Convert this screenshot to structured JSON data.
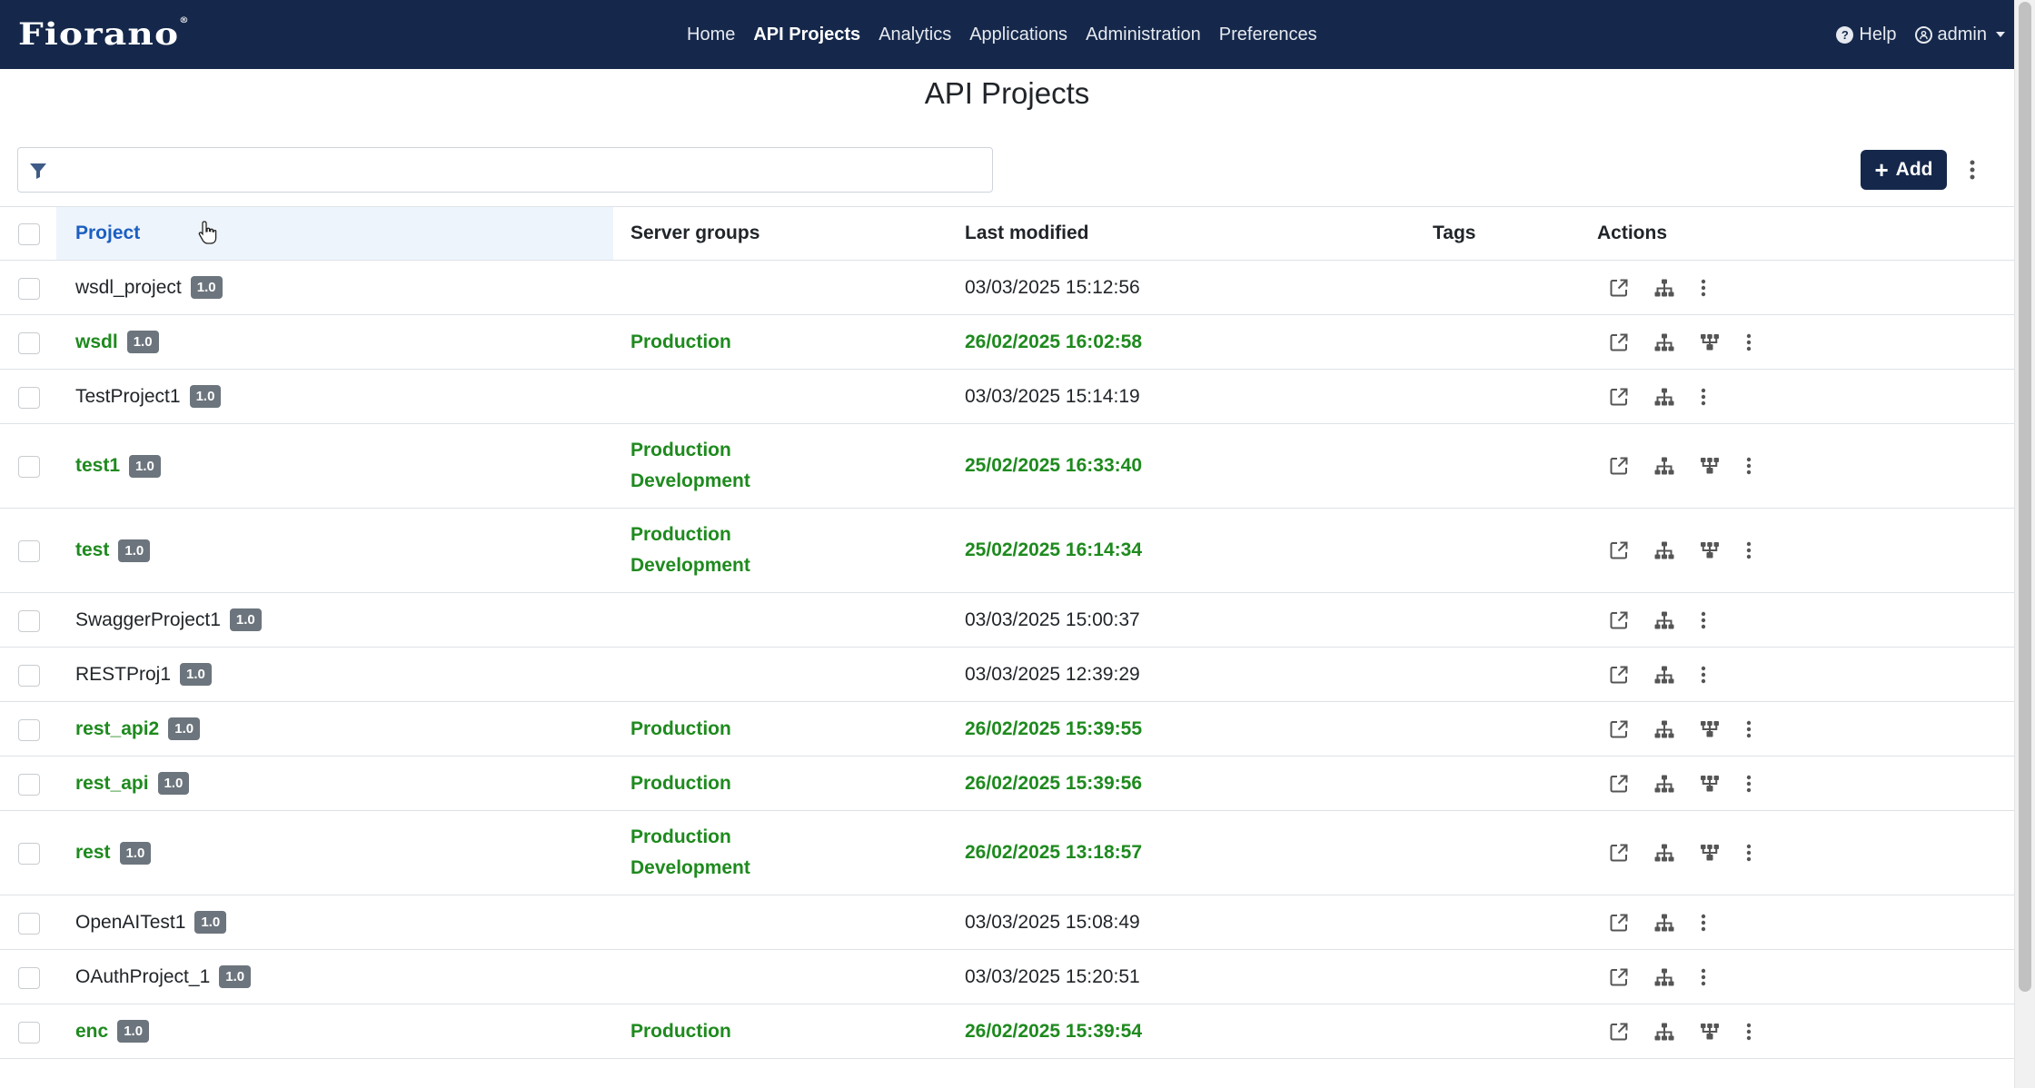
{
  "navbar": {
    "brand": "Fiorano",
    "links": [
      {
        "label": "Home",
        "active": false
      },
      {
        "label": "API Projects",
        "active": true
      },
      {
        "label": "Analytics",
        "active": false
      },
      {
        "label": "Applications",
        "active": false
      },
      {
        "label": "Administration",
        "active": false
      },
      {
        "label": "Preferences",
        "active": false
      }
    ],
    "help_label": "Help",
    "user_label": "admin",
    "icons": {
      "help": "question-circle-icon",
      "user": "user-circle-icon"
    }
  },
  "page": {
    "title": "API Projects",
    "filter_placeholder": "",
    "add_label": "Add"
  },
  "table": {
    "columns": [
      "Project",
      "Server groups",
      "Last modified",
      "Tags",
      "Actions"
    ],
    "rows": [
      {
        "name": "wsdl_project",
        "version": "1.0",
        "groups": [],
        "modified": "03/03/2025 15:12:56",
        "deployed": false
      },
      {
        "name": "wsdl",
        "version": "1.0",
        "groups": [
          "Production"
        ],
        "modified": "26/02/2025 16:02:58",
        "deployed": true
      },
      {
        "name": "TestProject1",
        "version": "1.0",
        "groups": [],
        "modified": "03/03/2025 15:14:19",
        "deployed": false
      },
      {
        "name": "test1",
        "version": "1.0",
        "groups": [
          "Production",
          "Development"
        ],
        "modified": "25/02/2025 16:33:40",
        "deployed": true
      },
      {
        "name": "test",
        "version": "1.0",
        "groups": [
          "Production",
          "Development"
        ],
        "modified": "25/02/2025 16:14:34",
        "deployed": true
      },
      {
        "name": "SwaggerProject1",
        "version": "1.0",
        "groups": [],
        "modified": "03/03/2025 15:00:37",
        "deployed": false
      },
      {
        "name": "RESTProj1",
        "version": "1.0",
        "groups": [],
        "modified": "03/03/2025 12:39:29",
        "deployed": false
      },
      {
        "name": "rest_api2",
        "version": "1.0",
        "groups": [
          "Production"
        ],
        "modified": "26/02/2025 15:39:55",
        "deployed": true
      },
      {
        "name": "rest_api",
        "version": "1.0",
        "groups": [
          "Production"
        ],
        "modified": "26/02/2025 15:39:56",
        "deployed": true
      },
      {
        "name": "rest",
        "version": "1.0",
        "groups": [
          "Production",
          "Development"
        ],
        "modified": "26/02/2025 13:18:57",
        "deployed": true
      },
      {
        "name": "OpenAITest1",
        "version": "1.0",
        "groups": [],
        "modified": "03/03/2025 15:08:49",
        "deployed": false
      },
      {
        "name": "OAuthProject_1",
        "version": "1.0",
        "groups": [],
        "modified": "03/03/2025 15:20:51",
        "deployed": false
      },
      {
        "name": "enc",
        "version": "1.0",
        "groups": [
          "Production"
        ],
        "modified": "26/02/2025 15:39:54",
        "deployed": true
      }
    ],
    "action_icons": [
      "external-link-icon",
      "sitemap-icon",
      "deploy-tree-icon",
      "more-vertical-icon"
    ]
  },
  "colors": {
    "navbar": "#15284b",
    "deployed_text": "#1e8a1e",
    "sorted_header": "#1b5fc1",
    "badge": "#6c757d"
  }
}
